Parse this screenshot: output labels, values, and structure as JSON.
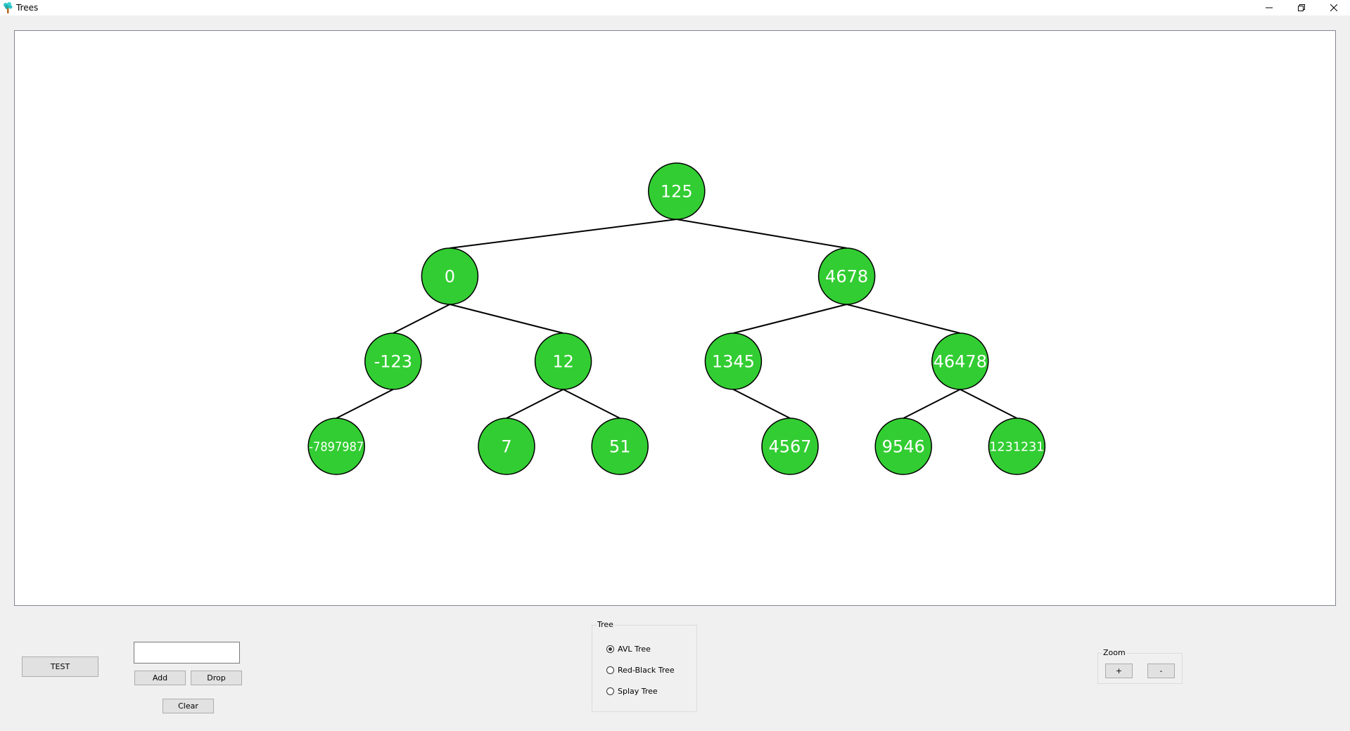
{
  "window": {
    "title": "Trees",
    "controls": {
      "minimize": "minimize-icon",
      "restore": "restore-icon",
      "close": "close-icon"
    }
  },
  "tree": {
    "node_color": "#32cd32",
    "nodes": [
      {
        "id": "n125",
        "value": "125",
        "level": 0,
        "slot": 8,
        "parent": null
      },
      {
        "id": "n0",
        "value": "0",
        "level": 1,
        "slot": 4,
        "parent": "n125"
      },
      {
        "id": "n4678",
        "value": "4678",
        "level": 1,
        "slot": 11,
        "parent": "n125"
      },
      {
        "id": "n-123",
        "value": "-123",
        "level": 2,
        "slot": 3,
        "parent": "n0"
      },
      {
        "id": "n12",
        "value": "12",
        "level": 2,
        "slot": 6,
        "parent": "n0"
      },
      {
        "id": "n1345",
        "value": "1345",
        "level": 2,
        "slot": 9,
        "parent": "n4678"
      },
      {
        "id": "n46478",
        "value": "46478",
        "level": 2,
        "slot": 13,
        "parent": "n4678"
      },
      {
        "id": "n-7897987",
        "value": "-7897987",
        "level": 3,
        "slot": 2,
        "parent": "n-123"
      },
      {
        "id": "n7",
        "value": "7",
        "level": 3,
        "slot": 5,
        "parent": "n12"
      },
      {
        "id": "n51",
        "value": "51",
        "level": 3,
        "slot": 7,
        "parent": "n12"
      },
      {
        "id": "n4567",
        "value": "4567",
        "level": 3,
        "slot": 10,
        "parent": "n1345"
      },
      {
        "id": "n9546",
        "value": "9546",
        "level": 3,
        "slot": 12,
        "parent": "n46478"
      },
      {
        "id": "n1231231",
        "value": "1231231",
        "level": 3,
        "slot": 14,
        "parent": "n46478"
      }
    ]
  },
  "controls": {
    "test_label": "TEST",
    "value_input": "",
    "add_label": "Add",
    "drop_label": "Drop",
    "clear_label": "Clear"
  },
  "tree_type": {
    "label": "Tree",
    "options": [
      {
        "label": "AVL Tree",
        "checked": true
      },
      {
        "label": "Red-Black Tree",
        "checked": false
      },
      {
        "label": "Splay Tree",
        "checked": false
      }
    ]
  },
  "zoom": {
    "label": "Zoom",
    "in_label": "+",
    "out_label": "-"
  }
}
